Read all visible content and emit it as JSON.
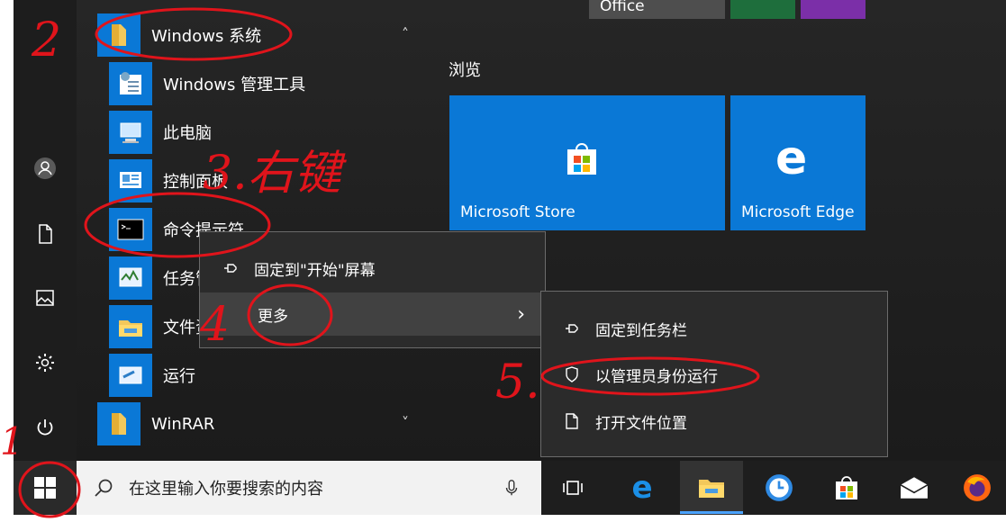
{
  "app_list": {
    "windows_system_folder": "Windows 系统",
    "items": [
      "Windows 管理工具",
      "此电脑",
      "控制面板",
      "命令提示符",
      "任务管理器",
      "文件资源管理器",
      "运行"
    ],
    "winrar_folder": "WinRAR"
  },
  "tiles": {
    "top_partial_label": "Office",
    "group_label": "浏览",
    "store_label": "Microsoft Store",
    "edge_label": "Microsoft Edge"
  },
  "context_menu": {
    "pin_start": "固定到\"开始\"屏幕",
    "more": "更多"
  },
  "submenu": {
    "pin_taskbar": "固定到任务栏",
    "run_as_admin": "以管理员身份运行",
    "open_location": "打开文件位置"
  },
  "taskbar": {
    "search_placeholder": "在这里输入你要搜索的内容"
  },
  "annotations": {
    "step1": "1",
    "step2": "2",
    "step3": "3.右键",
    "step4": "4",
    "step5": "5."
  },
  "colors": {
    "tile_blue": "#0a78d6",
    "annotation_red": "#e0141b"
  }
}
